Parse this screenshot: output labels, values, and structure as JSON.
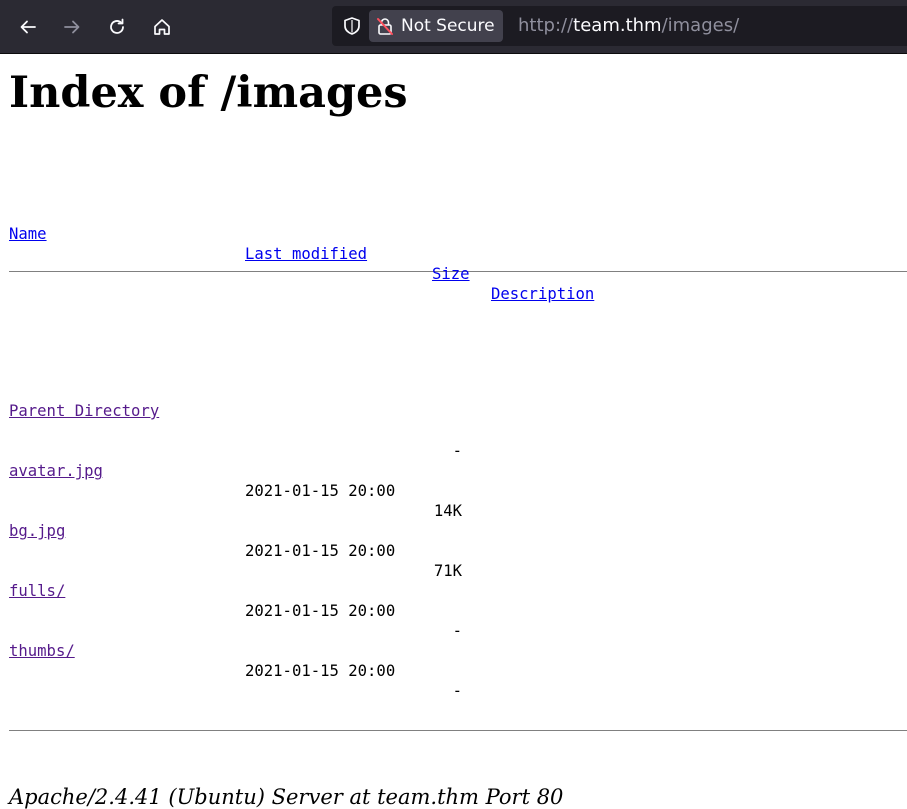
{
  "browser": {
    "security_label": "Not Secure",
    "url_scheme": "http://",
    "url_host": "team.thm",
    "url_path": "/images/",
    "icons": [
      "back-icon",
      "forward-icon",
      "reload-icon",
      "home-icon",
      "shield-icon",
      "insecure-lock-icon"
    ]
  },
  "page": {
    "title": "Index of /images",
    "columns": {
      "name": "Name",
      "last_modified": "Last modified",
      "size": "Size",
      "description": "Description"
    },
    "entries": [
      {
        "name": "Parent Directory",
        "modified": "",
        "size": "-"
      },
      {
        "name": "avatar.jpg",
        "modified": "2021-01-15 20:00",
        "size": "14K"
      },
      {
        "name": "bg.jpg",
        "modified": "2021-01-15 20:00",
        "size": "71K"
      },
      {
        "name": "fulls/",
        "modified": "2021-01-15 20:00",
        "size": "-"
      },
      {
        "name": "thumbs/",
        "modified": "2021-01-15 20:00",
        "size": "-"
      }
    ],
    "footer": "Apache/2.4.41 (Ubuntu) Server at team.thm Port 80"
  }
}
